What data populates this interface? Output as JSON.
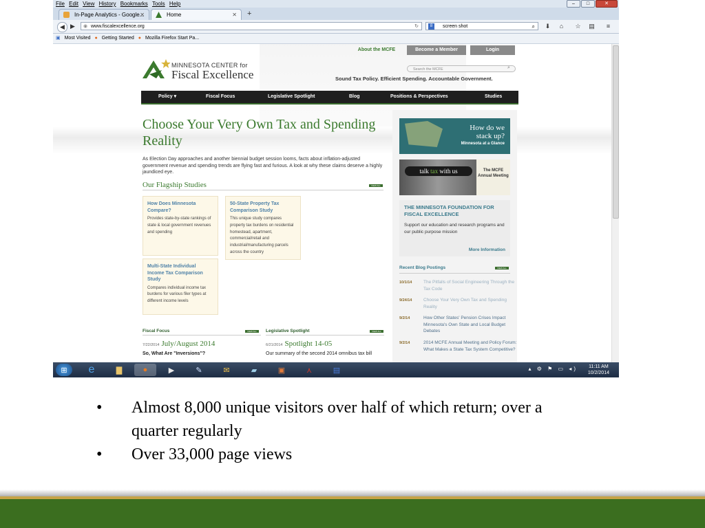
{
  "browser": {
    "menu": [
      "File",
      "Edit",
      "View",
      "History",
      "Bookmarks",
      "Tools",
      "Help"
    ],
    "tabs": [
      {
        "title": "In-Page Analytics - Google...",
        "active": false
      },
      {
        "title": "Home",
        "active": true
      }
    ],
    "url": "www.fiscalexcellence.org",
    "search_value": "screen shot",
    "bookmarks": [
      "Most Visited",
      "Getting Started",
      "Mozilla Firefox Start Pa..."
    ]
  },
  "site": {
    "top_links": {
      "about": "About the MCFE",
      "member": "Become a Member",
      "login": "Login"
    },
    "logo_line1": "MINNESOTA CENTER for",
    "logo_line2": "Fiscal Excellence",
    "search_placeholder": "Search the MCFE",
    "tagline": "Sound Tax Policy. Efficient Spending. Accountable Government.",
    "nav": [
      "Policy ▾",
      "Fiscal Focus",
      "Legislative Spotlight",
      "Blog",
      "Positions & Perspectives",
      "Studies"
    ],
    "headline": "Choose Your Very Own Tax and Spending Reality",
    "intro": "As Election Day approaches and another biennial budget session looms, facts about inflation-adjusted government revenue and spending trends are flying fast and furious.  A look at why these claims deserve a highly jaundiced eye.",
    "flagship_title": "Our Flagship Studies",
    "view_all": "VIEW ALL",
    "studies": [
      {
        "title": "How Does Minnesota Compare?",
        "body": "Provides state-by-state rankings of state & local government revenues and spending"
      },
      {
        "title": "50-State Property Tax Comparison Study",
        "body": "This unique study compares property tax burdens on residential homestead, apartment, commercial/retail and industrial/manufacturing parcels across the country"
      },
      {
        "title": "Multi-State Individual Income Tax Comparison Study",
        "body": "Compares individual income tax burdens for various filer types at different income levels"
      }
    ],
    "fiscal_focus": {
      "label": "Fiscal Focus",
      "date": "7/22/2014",
      "title": "July/August 2014",
      "snippet": "So, What Are \"Inversions\"?"
    },
    "legislative_spotlight": {
      "label": "Legislative Spotlight",
      "date": "6/21/2014",
      "title": "Spotlight 14-05",
      "snippet": "Our summary of the second 2014 omnibus tax bill"
    },
    "sidebar": {
      "howdo_line1": "How do we",
      "howdo_line2": "stack up?",
      "howdo_sub": "Minnesota at a Glance",
      "talk_pre": "talk ",
      "talk_tax": "tax",
      "talk_post": " with us",
      "meeting": "The MCFE Annual Meeting",
      "foundation_title": "THE MINNESOTA FOUNDATION FOR FISCAL EXCELLENCE",
      "foundation_body": "Support our education and research programs and our public purpose mission",
      "foundation_more": "More Information",
      "blog_title": "Recent Blog Postings",
      "blog": [
        {
          "date": "10/1/14",
          "title": "The Pitfalls of Social Engineering Through the Tax Code"
        },
        {
          "date": "9/24/14",
          "title": "Choose Your Very Own Tax and Spending Reality"
        },
        {
          "date": "9/2/14",
          "title": "How Other States' Pension Crises Impact Minnesota's Own State and Local Budget Debates"
        },
        {
          "date": "9/2/14",
          "title": "2014 MCFE Annual Meeting and Policy Forum: What Makes a State Tax System Competitive?"
        }
      ]
    }
  },
  "taskbar": {
    "time": "11:11 AM",
    "date": "10/2/2014"
  },
  "bullets": [
    "Almost 8,000 unique visitors over half of which return; over a quarter regularly",
    "Over 33,000 page views"
  ],
  "colors": {
    "brand_green": "#3b7a2e",
    "footer_green": "#3b6e1f",
    "gold": "#c7a447",
    "link_blue": "#4f82a8"
  }
}
